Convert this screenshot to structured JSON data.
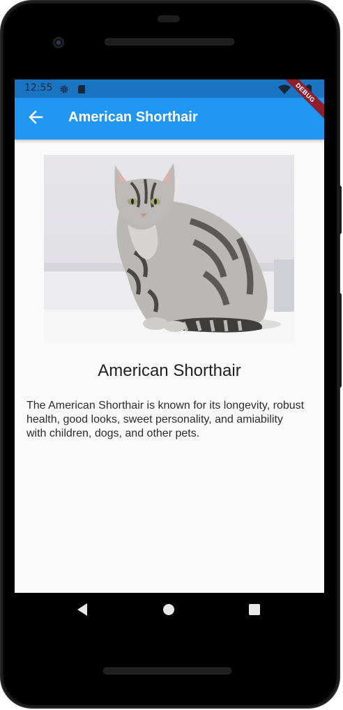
{
  "status_bar": {
    "time": "12:55",
    "icons": [
      "settings-gear-icon",
      "sd-card-icon",
      "wifi-icon",
      "battery-icon"
    ]
  },
  "app_bar": {
    "title": "American Shorthair",
    "back_icon": "arrow-left-icon",
    "color": "#2196f3"
  },
  "debug_banner": "DEBUG",
  "detail": {
    "image": "cat-photo",
    "name": "American Shorthair",
    "description": "The American Shorthair is known for its longevity, robust health, good looks, sweet personality, and amiability with children, dogs, and other pets."
  },
  "nav_bar": {
    "buttons": [
      "back-triangle-icon",
      "home-circle-icon",
      "recents-square-icon"
    ]
  }
}
